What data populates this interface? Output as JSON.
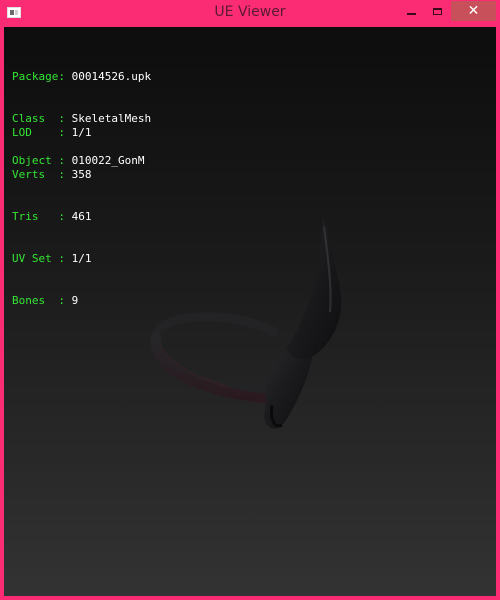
{
  "window": {
    "title": "UE Viewer",
    "controls": {
      "close_glyph": "✕"
    }
  },
  "info_block_1": [
    {
      "key": "Package:",
      "value": "00014526.upk"
    },
    {
      "key": "Class  :",
      "value": "SkeletalMesh"
    },
    {
      "key": "Object :",
      "value": "010022_GonM"
    }
  ],
  "info_block_2": [
    {
      "key": "LOD    :",
      "value": "1/1"
    },
    {
      "key": "Verts  :",
      "value": "358"
    },
    {
      "key": "Tris   :",
      "value": "461"
    },
    {
      "key": "UV Set :",
      "value": "1/1"
    },
    {
      "key": "Bones  :",
      "value": "9"
    }
  ],
  "colors": {
    "titlebar": "#fb2c74",
    "label_green": "#33e633",
    "value_white": "#ffffff",
    "close_button": "#c7505a"
  }
}
